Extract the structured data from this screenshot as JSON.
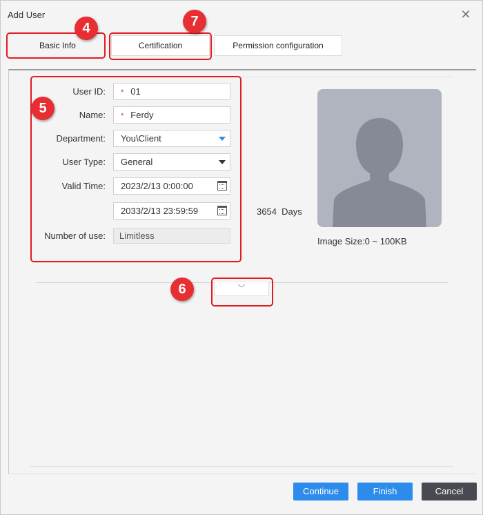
{
  "dialog": {
    "title": "Add User"
  },
  "tabs": [
    {
      "label": "Basic Info"
    },
    {
      "label": "Certification"
    },
    {
      "label": "Permission configuration"
    }
  ],
  "form": {
    "user_id": {
      "label": "User ID:",
      "required_mark": "*",
      "value": "01"
    },
    "name": {
      "label": "Name:",
      "required_mark": "*",
      "value": "Ferdy"
    },
    "department": {
      "label": "Department:",
      "value": "You\\Client"
    },
    "user_type": {
      "label": "User Type:",
      "value": "General"
    },
    "valid_time": {
      "label": "Valid Time:",
      "start": "2023/2/13 0:00:00",
      "end": "2033/2/13 23:59:59",
      "days": "3654  Days"
    },
    "number_of_use": {
      "label": "Number of use:",
      "value": "Limitless"
    }
  },
  "photo": {
    "image_size": "Image Size:0 ~ 100KB"
  },
  "expand": {
    "icon": "chevron-down-icon",
    "glyph": "﹀"
  },
  "buttons": {
    "continue": "Continue",
    "finish": "Finish",
    "cancel": "Cancel"
  },
  "annotations": [
    "4",
    "5",
    "6",
    "7"
  ],
  "colors": {
    "primary": "#2d8ceb",
    "cancel": "#474b51",
    "annotation": "#e62e33",
    "dept_arrow": "#2d8ceb"
  }
}
